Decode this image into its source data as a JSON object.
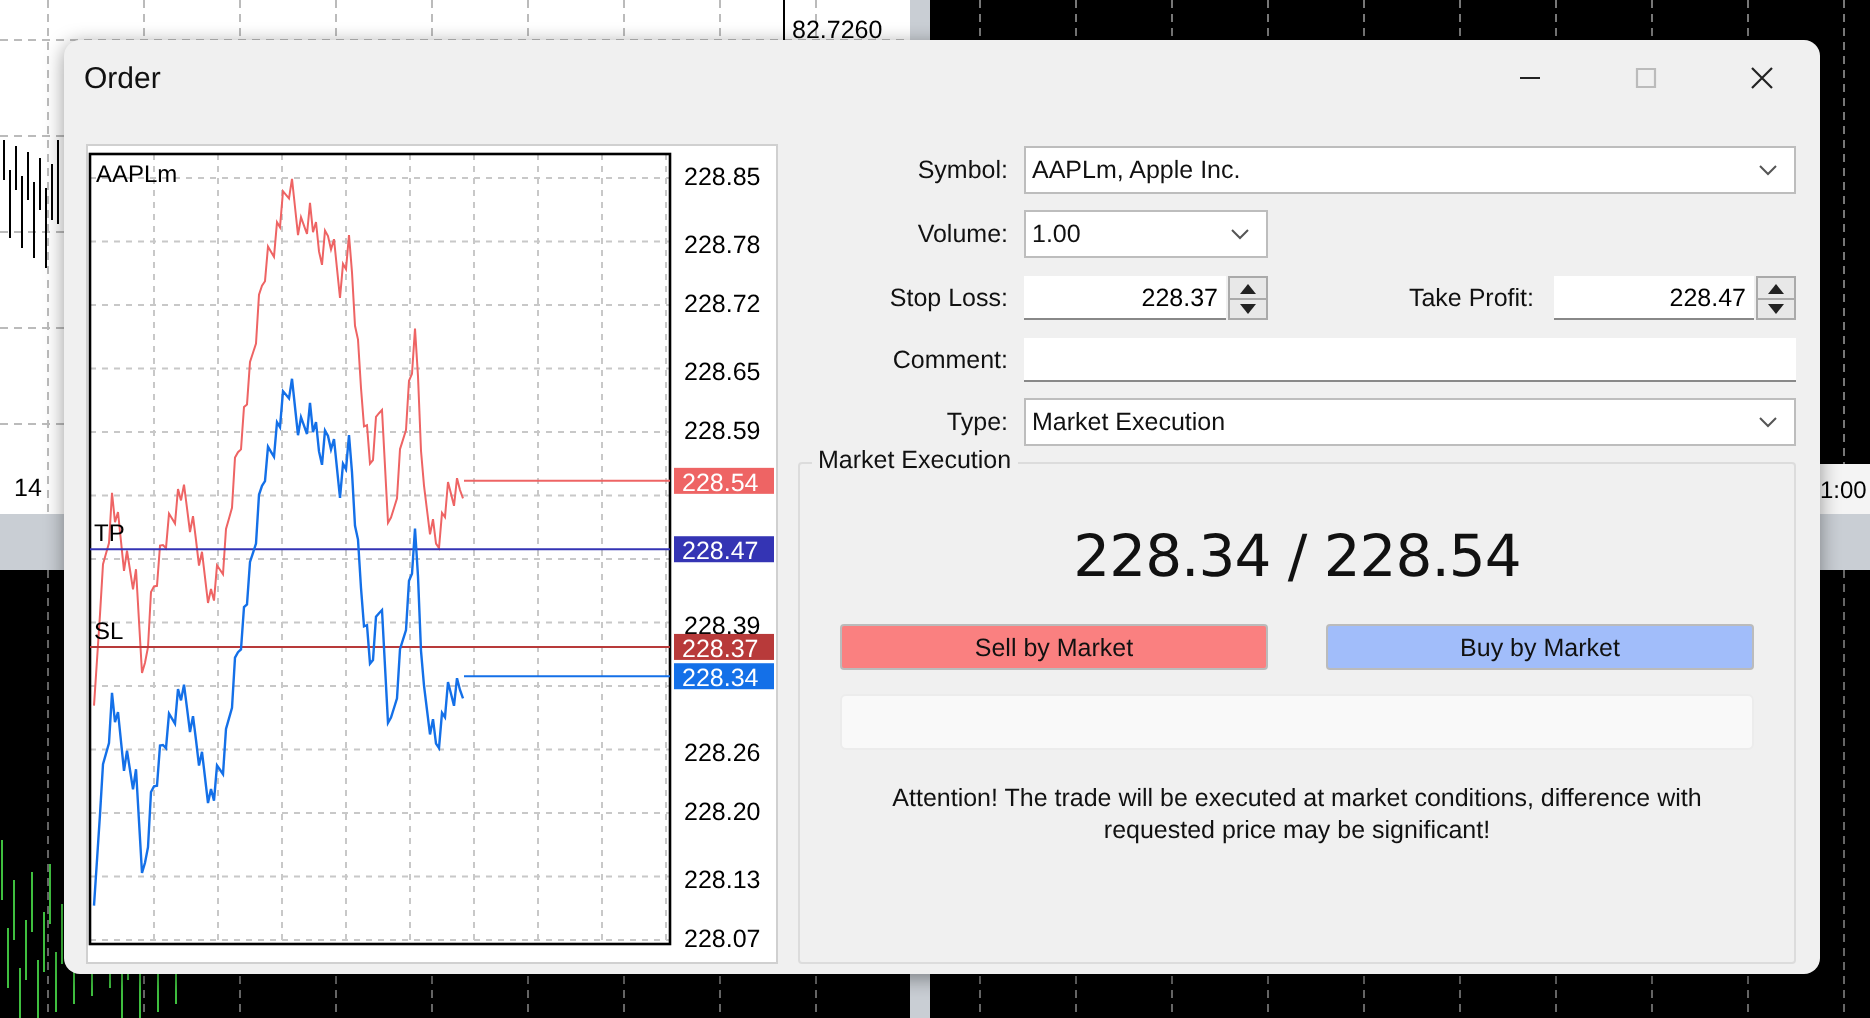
{
  "background": {
    "texts": [
      {
        "kind": "price",
        "text": "82.7260"
      },
      {
        "kind": "date",
        "text": "14"
      },
      {
        "kind": "time",
        "text": "1:00"
      }
    ]
  },
  "window": {
    "title": "Order"
  },
  "chart": {
    "symbol": "AAPLm",
    "axis_labels": [
      "228.85",
      "228.78",
      "228.72",
      "228.65",
      "228.59",
      "228.39",
      "228.26",
      "228.20",
      "228.13",
      "228.07"
    ],
    "price_lines": [
      {
        "kind": "ask",
        "marker": "228.54",
        "color": "#ee6464"
      },
      {
        "kind": "take_profit",
        "line_label": "TP",
        "marker": "228.47",
        "color": "#3434b4"
      },
      {
        "kind": "stop_loss",
        "line_label": "SL",
        "marker": "228.37",
        "color": "#b83a3a"
      },
      {
        "kind": "bid",
        "marker": "228.34",
        "color": "#1470e8"
      }
    ]
  },
  "form": {
    "symbol": {
      "label": "Symbol:",
      "value": "AAPLm, Apple Inc."
    },
    "volume": {
      "label": "Volume:",
      "value": "1.00"
    },
    "stop_loss": {
      "label": "Stop Loss:",
      "value": "228.37"
    },
    "take_profit": {
      "label": "Take Profit:",
      "value": "228.47"
    },
    "comment": {
      "label": "Comment:"
    },
    "type": {
      "label": "Type:",
      "value": "Market Execution"
    }
  },
  "market_execution": {
    "title": "Market Execution",
    "quote": "228.34 / 228.54",
    "buttons": [
      {
        "kind": "sell",
        "label": "Sell by Market"
      },
      {
        "kind": "buy",
        "label": "Buy by Market"
      }
    ],
    "message": "Attention! The trade will be executed at market conditions, difference with requested price may be significant!"
  }
}
